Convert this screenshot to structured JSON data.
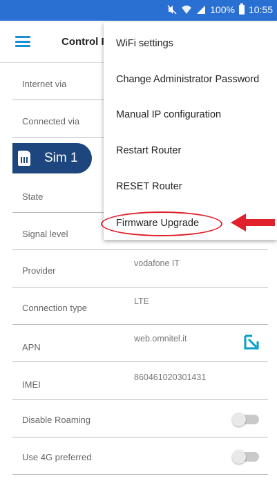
{
  "status_bar": {
    "battery": "100%",
    "time": "10:55",
    "icons": [
      "mute-icon",
      "wifi-icon",
      "signal-icon",
      "battery-icon"
    ]
  },
  "header": {
    "title": "Control P",
    "menu_icon": "hamburger-icon"
  },
  "rows": {
    "internet_via": {
      "label": "Internet via"
    },
    "connected_via": {
      "label": "Connected via"
    },
    "sim_tab": {
      "label": "Sim 1"
    },
    "state": {
      "label": "State"
    },
    "signal_level": {
      "label": "Signal level"
    },
    "provider": {
      "label": "Provider",
      "value": "vodafone IT"
    },
    "connection_type": {
      "label": "Connection type",
      "value": "LTE"
    },
    "apn": {
      "label": "APN",
      "value": "web.omnitel.it"
    },
    "imei": {
      "label": "IMEI",
      "value": "860461020301431"
    },
    "disable_roaming": {
      "label": "Disable Roaming",
      "enabled": false
    },
    "use_4g": {
      "label": "Use 4G preferred",
      "enabled": false
    }
  },
  "menu": {
    "items": [
      "WiFi settings",
      "Change Administrator Password",
      "Manual IP configuration",
      "Restart Router",
      "RESET Router",
      "Firmware Upgrade"
    ]
  },
  "colors": {
    "status_bar": "#2a6fd2",
    "accent": "#1a8fd6",
    "sim_tab": "#1e467e",
    "annotation": "#e0202a"
  }
}
